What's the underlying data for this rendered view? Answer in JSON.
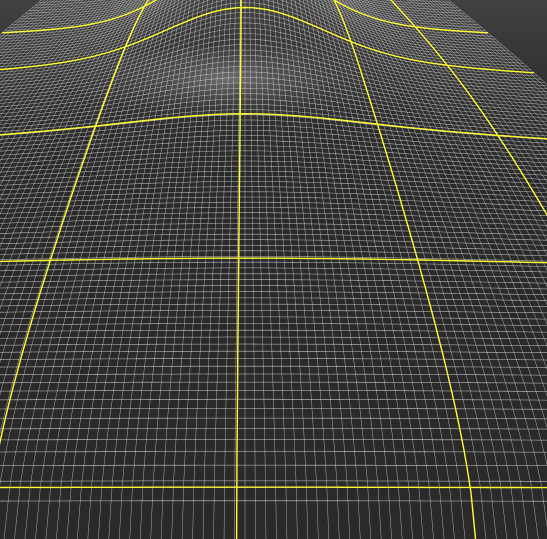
{
  "scene": {
    "view": "3d-terrain-wireframe",
    "background_color": "#2a2a2a",
    "mesh_color": "#e8e8e8",
    "grid_line_color": "#ffff33",
    "lit_terrain_color": "#8a8a8a"
  }
}
